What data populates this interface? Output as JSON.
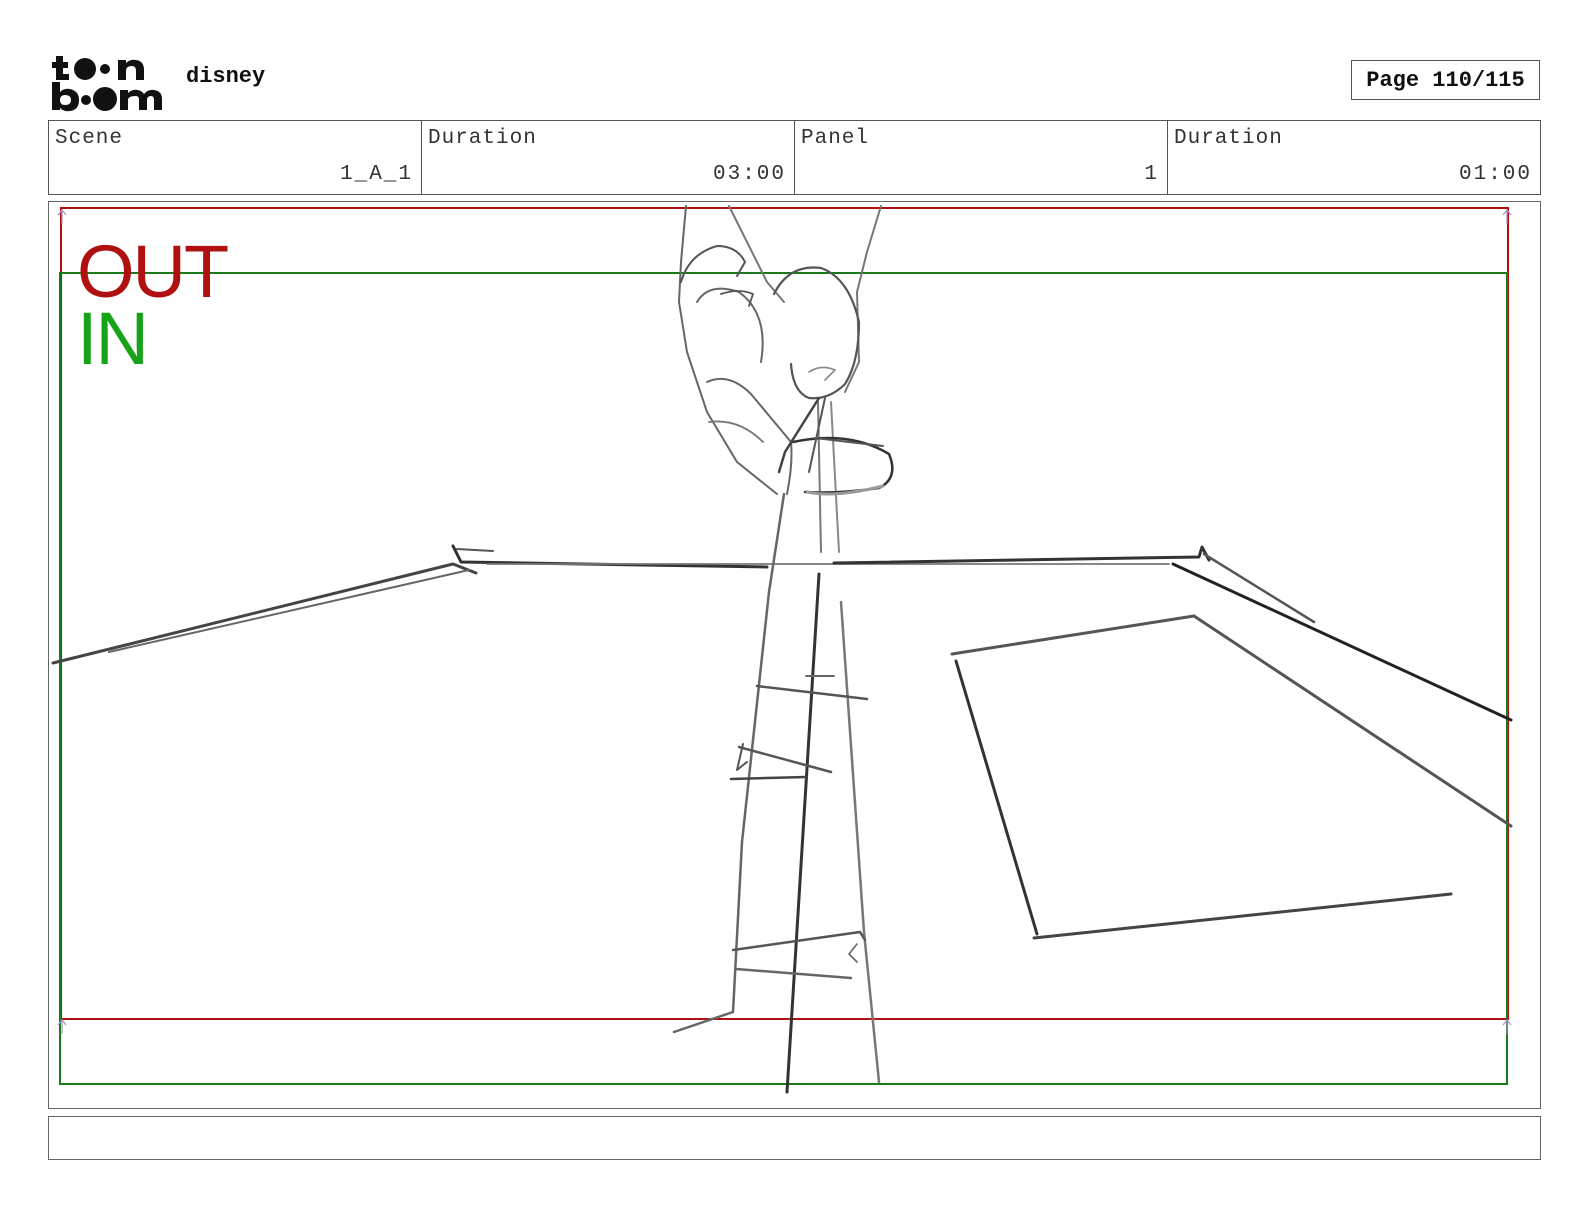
{
  "header": {
    "logo_text": "toon boom",
    "project_name": "disney",
    "page_label": "Page 110/115"
  },
  "info": {
    "scene_label": "Scene",
    "scene_value": "1_A_1",
    "scene_duration_label": "Duration",
    "scene_duration_value": "03:00",
    "panel_label": "Panel",
    "panel_value": "1",
    "panel_duration_label": "Duration",
    "panel_duration_value": "01:00"
  },
  "frame": {
    "out_label": "OUT",
    "in_label": "IN",
    "out_color": "#b01010",
    "in_color": "#17a317"
  },
  "notes": {
    "text": ""
  }
}
